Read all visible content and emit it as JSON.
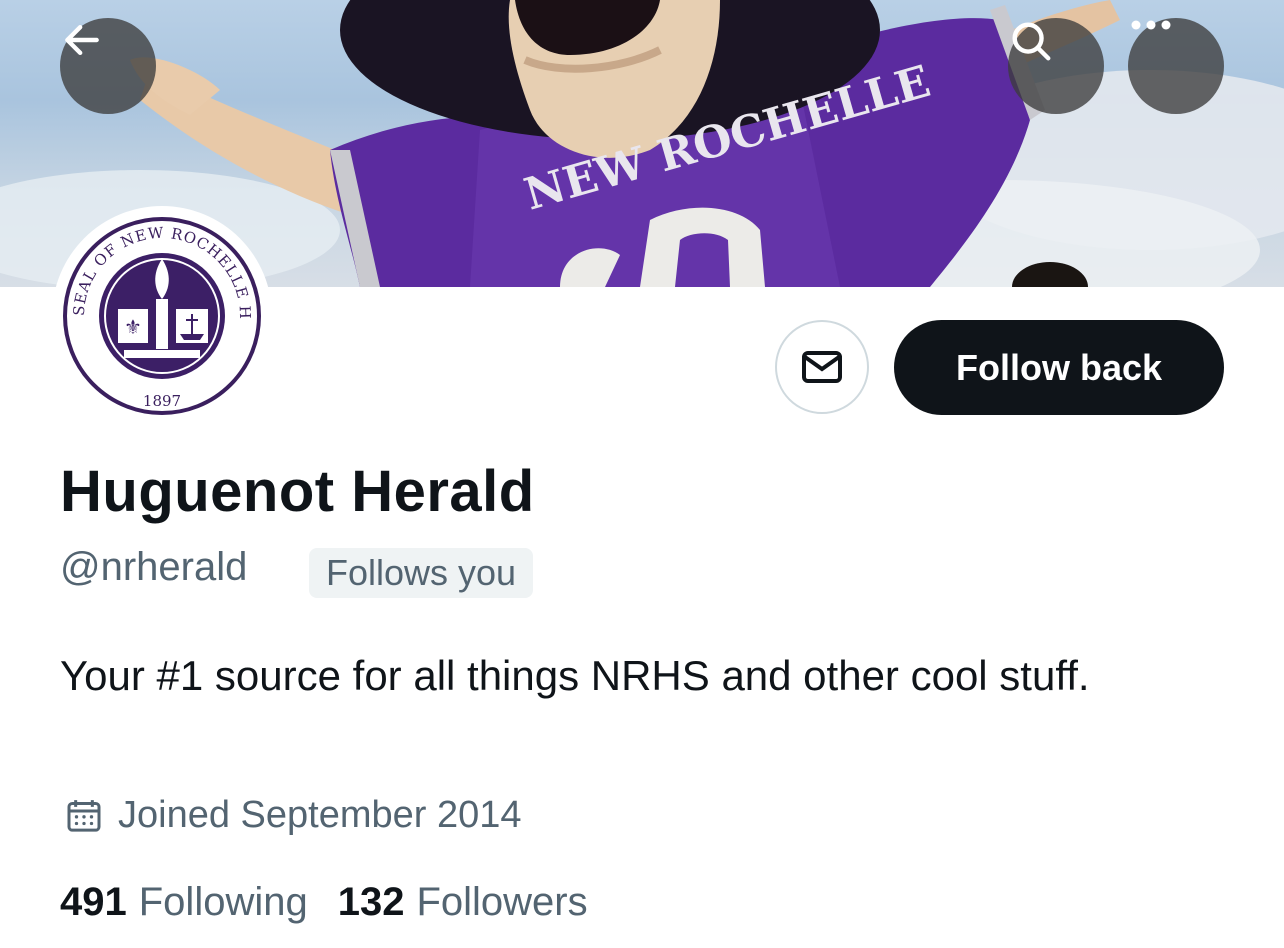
{
  "header": {
    "back_icon": "arrow-left-icon",
    "search_icon": "search-icon",
    "more_icon": "more-horizontal-icon"
  },
  "banner": {
    "jersey_text": "NEW ROCHELLE",
    "colors": {
      "jersey": "#5a2a9c",
      "sky": "#b9d0e6"
    }
  },
  "avatar": {
    "seal_text_top": "SEAL OF NEW ROCHELLE HIGH SCHOOL",
    "seal_year": "1897"
  },
  "actions": {
    "message_icon": "envelope-icon",
    "follow_back_label": "Follow back"
  },
  "profile": {
    "display_name": "Huguenot Herald",
    "handle": "@nrherald",
    "follows_you_label": "Follows you",
    "bio": "Your #1 source for all things NRHS and other cool stuff.",
    "joined_icon": "calendar-icon",
    "joined": "Joined September 2014",
    "stats": {
      "following_count": "491",
      "following_label": "Following",
      "followers_count": "132",
      "followers_label": "Followers"
    }
  },
  "colors": {
    "primary_text": "#0f1419",
    "secondary_text": "#536471",
    "button_dark": "#0f1419",
    "badge_bg": "#eff3f4"
  }
}
